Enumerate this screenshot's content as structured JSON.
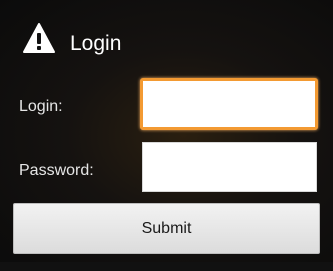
{
  "dialog": {
    "title": "Login",
    "title_icon": "warning-icon",
    "login_label": "Login:",
    "login_value": "",
    "password_label": "Password:",
    "password_value": "",
    "submit_label": "Submit"
  },
  "colors": {
    "background": "#0d0d0d",
    "focus_border": "#f39a32",
    "input_background": "#ffffff",
    "button_background": "#e6e6e6"
  }
}
